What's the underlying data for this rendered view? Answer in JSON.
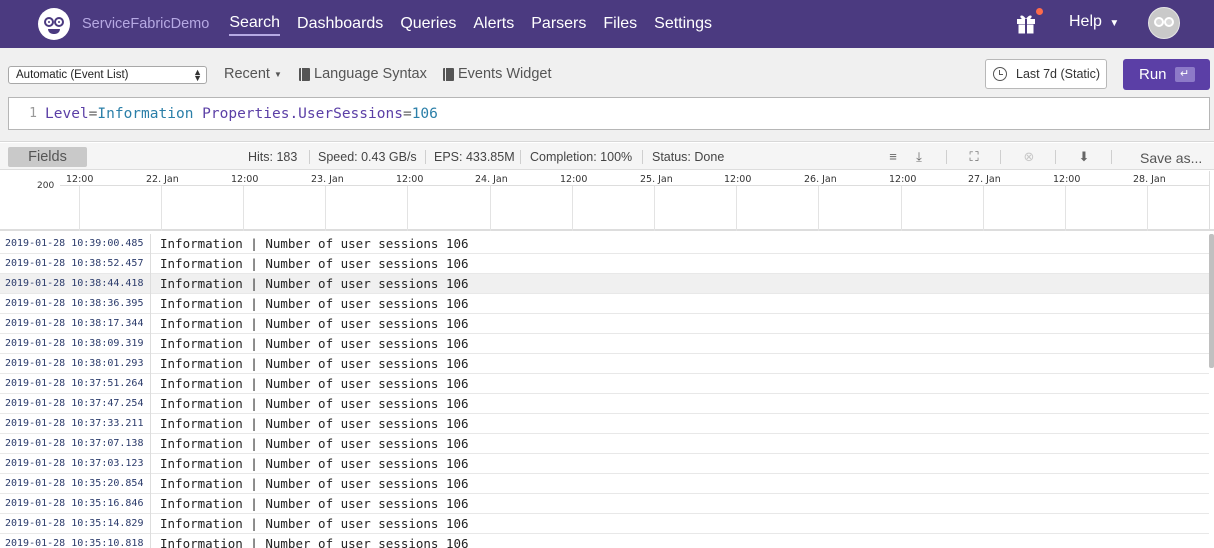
{
  "app": {
    "repo_name": "ServiceFabricDemo",
    "nav": [
      "Search",
      "Dashboards",
      "Queries",
      "Alerts",
      "Parsers",
      "Files",
      "Settings"
    ],
    "active_nav": "Search",
    "help_label": "Help"
  },
  "toolbar": {
    "mode_selected": "Automatic (Event List)",
    "recent_label": "Recent",
    "language_syntax_label": "Language Syntax",
    "events_widget_label": "Events Widget",
    "time_range_label": "Last 7d (Static)",
    "run_label": "Run",
    "run_key": "↵"
  },
  "query": {
    "line_number": "1",
    "tokens": {
      "field1": "Level",
      "op1": "=",
      "value1": "Information",
      "field2": "Properties.UserSessions",
      "op2": "=",
      "value2": "106"
    }
  },
  "stats": {
    "fields_label": "Fields",
    "hits": "Hits: 183",
    "speed": "Speed: 0.43 GB/s",
    "eps": "EPS: 433.85M",
    "completion": "Completion: 100%",
    "status": "Status: Done",
    "save_as_label": "Save as..."
  },
  "timeline": {
    "y_max_label": "200",
    "ticks": [
      "12:00",
      "22. Jan",
      "12:00",
      "23. Jan",
      "12:00",
      "24. Jan",
      "12:00",
      "25. Jan",
      "12:00",
      "26. Jan",
      "12:00",
      "27. Jan",
      "12:00",
      "28. Jan"
    ]
  },
  "events": [
    {
      "ts": "2019-01-28 10:39:00.485",
      "msg": "Information | Number of user sessions 106"
    },
    {
      "ts": "2019-01-28 10:38:52.457",
      "msg": "Information | Number of user sessions 106"
    },
    {
      "ts": "2019-01-28 10:38:44.418",
      "msg": "Information | Number of user sessions 106"
    },
    {
      "ts": "2019-01-28 10:38:36.395",
      "msg": "Information | Number of user sessions 106"
    },
    {
      "ts": "2019-01-28 10:38:17.344",
      "msg": "Information | Number of user sessions 106"
    },
    {
      "ts": "2019-01-28 10:38:09.319",
      "msg": "Information | Number of user sessions 106"
    },
    {
      "ts": "2019-01-28 10:38:01.293",
      "msg": "Information | Number of user sessions 106"
    },
    {
      "ts": "2019-01-28 10:37:51.264",
      "msg": "Information | Number of user sessions 106"
    },
    {
      "ts": "2019-01-28 10:37:47.254",
      "msg": "Information | Number of user sessions 106"
    },
    {
      "ts": "2019-01-28 10:37:33.211",
      "msg": "Information | Number of user sessions 106"
    },
    {
      "ts": "2019-01-28 10:37:07.138",
      "msg": "Information | Number of user sessions 106"
    },
    {
      "ts": "2019-01-28 10:37:03.123",
      "msg": "Information | Number of user sessions 106"
    },
    {
      "ts": "2019-01-28 10:35:20.854",
      "msg": "Information | Number of user sessions 106"
    },
    {
      "ts": "2019-01-28 10:35:16.846",
      "msg": "Information | Number of user sessions 106"
    },
    {
      "ts": "2019-01-28 10:35:14.829",
      "msg": "Information | Number of user sessions 106"
    },
    {
      "ts": "2019-01-28 10:35:10.818",
      "msg": "Information | Number of user sessions 106"
    }
  ],
  "colors": {
    "nav_bg": "#4b3a80",
    "accent": "#5b3fa6",
    "notification_dot": "#ff6b4a"
  }
}
